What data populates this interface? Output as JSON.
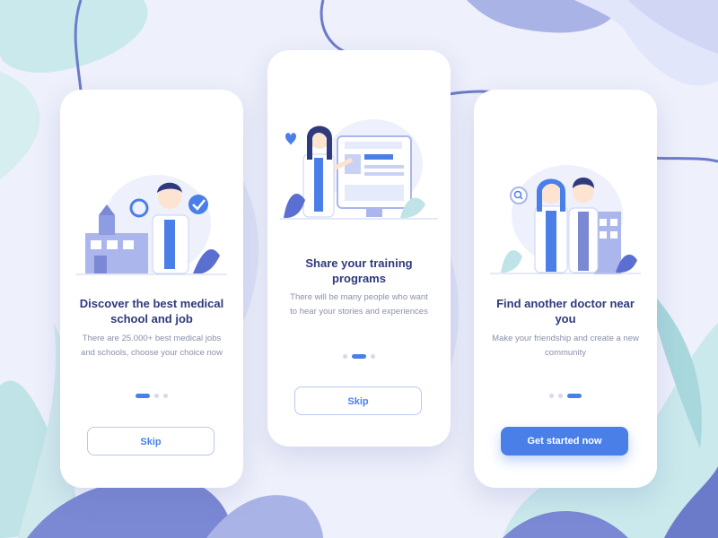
{
  "screens": [
    {
      "title": "Discover the best medical school and job",
      "description": "There are 25.000+ best medical jobs and schools, choose your choice now",
      "active_dot": 0,
      "button": {
        "label": "Skip",
        "style": "outline"
      },
      "illustration_icons": [
        "doctor-magnifier-icon",
        "hospital-building-icon",
        "checkmark-icon"
      ]
    },
    {
      "title": "Share your training programs",
      "description": "There will be many people who want to hear your stories and experiences",
      "active_dot": 1,
      "button": {
        "label": "Skip",
        "style": "outline"
      },
      "illustration_icons": [
        "doctor-presenting-icon",
        "monitor-icon",
        "heart-icon"
      ]
    },
    {
      "title": "Find another doctor near you",
      "description": "Make your friendship and create a new community",
      "active_dot": 2,
      "button": {
        "label": "Get started now",
        "style": "filled"
      },
      "illustration_icons": [
        "two-doctors-icon",
        "search-icon",
        "city-icon"
      ]
    }
  ],
  "colors": {
    "accent": "#4a7fe8",
    "title": "#2e3a7c",
    "text": "#8a90a8",
    "background": "#eef0fb",
    "leaf_teal": "#bfe3e6",
    "leaf_blue": "#7b88d4"
  }
}
